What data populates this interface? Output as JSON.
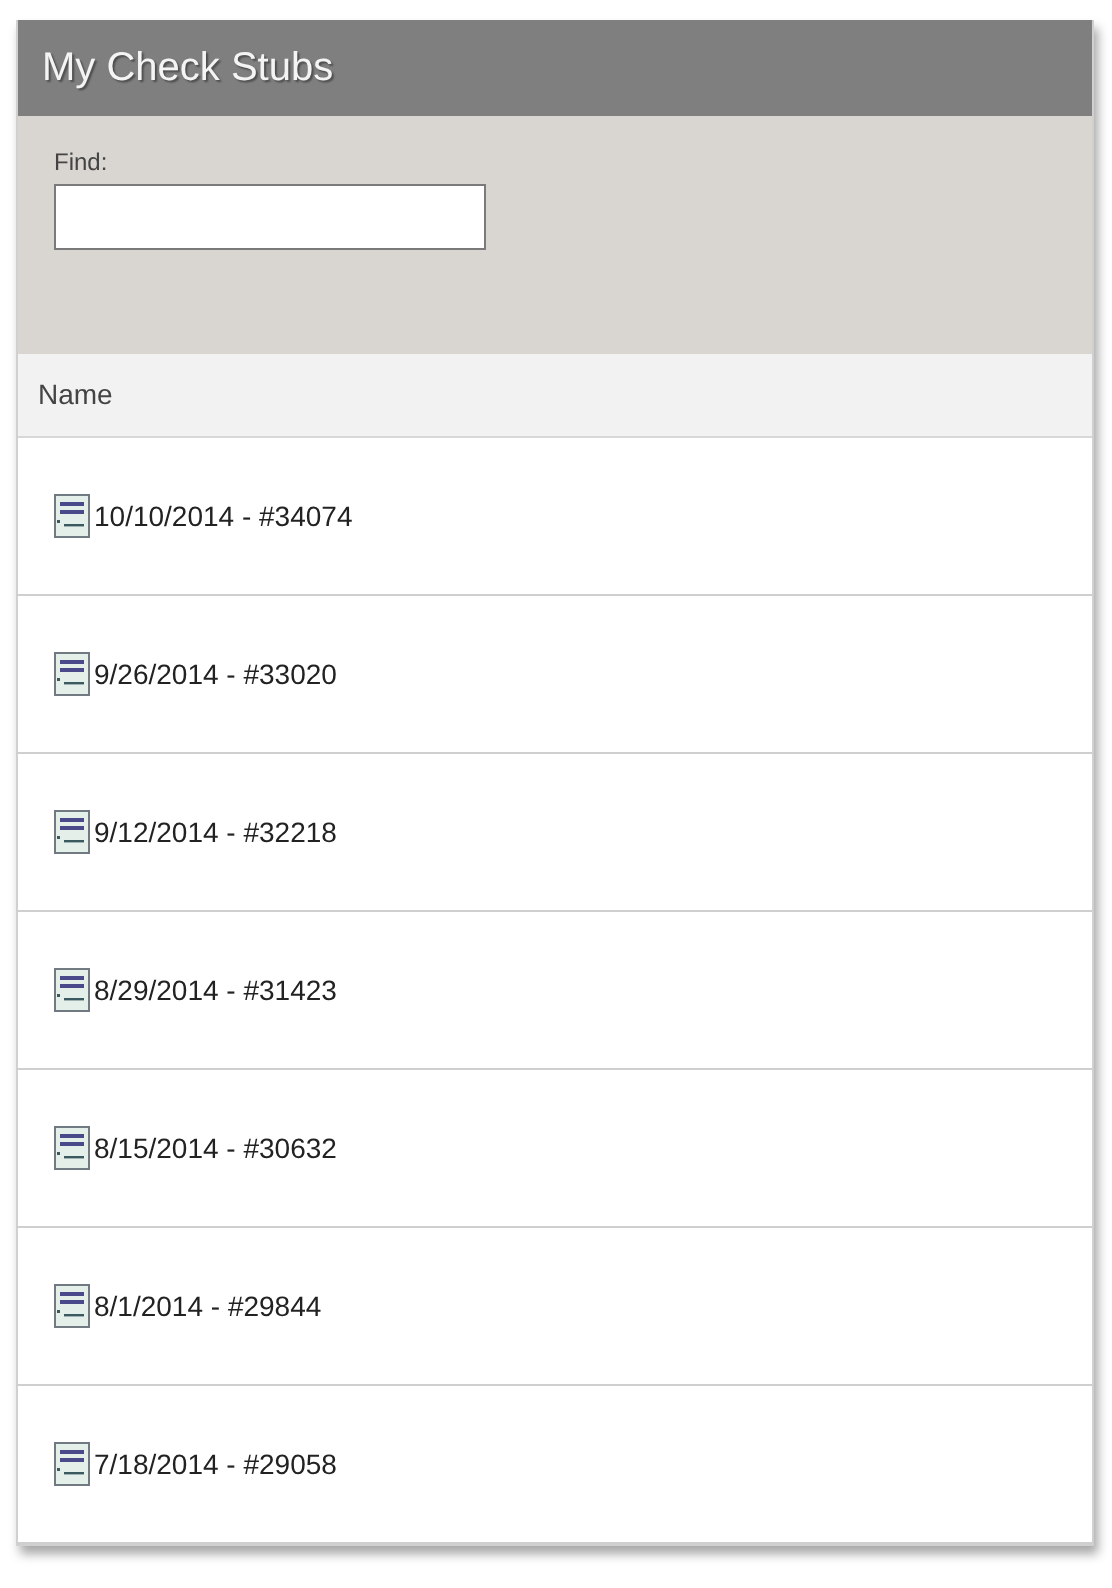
{
  "panel": {
    "title": "My Check Stubs"
  },
  "find": {
    "label": "Find:"
  },
  "table": {
    "columns": [
      "Name"
    ],
    "rows": [
      {
        "name": "10/10/2014 - #34074"
      },
      {
        "name": "9/26/2014 - #33020"
      },
      {
        "name": "9/12/2014 - #32218"
      },
      {
        "name": "8/29/2014 - #31423"
      },
      {
        "name": "8/15/2014 - #30632"
      },
      {
        "name": "8/1/2014 - #29844"
      },
      {
        "name": "7/18/2014 - #29058"
      }
    ]
  }
}
